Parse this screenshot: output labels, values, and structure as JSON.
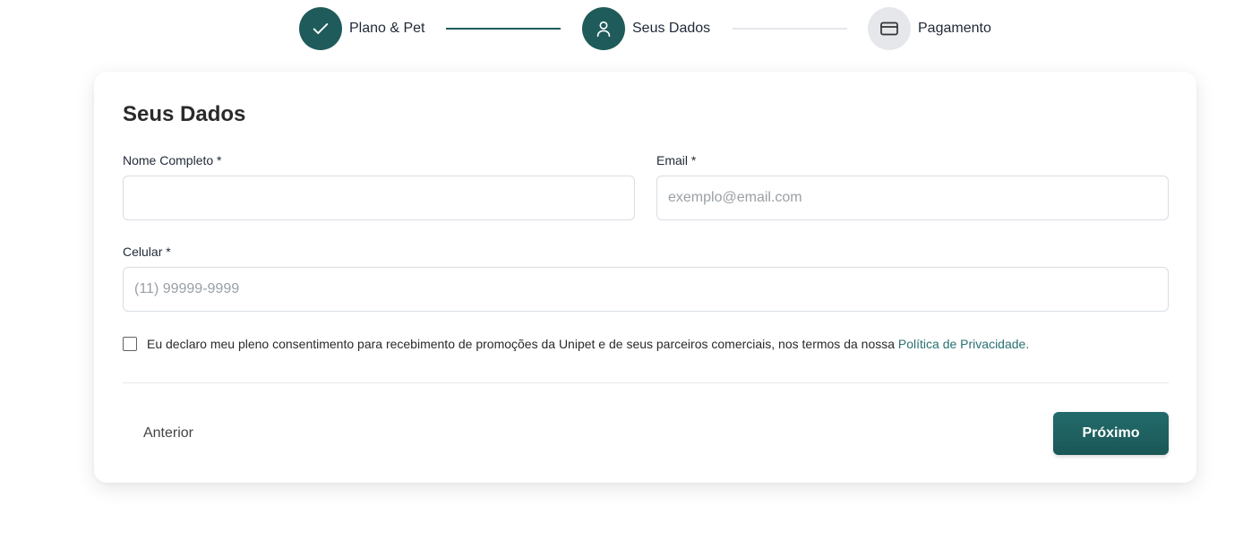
{
  "stepper": {
    "steps": [
      {
        "label": "Plano & Pet",
        "state": "completed",
        "icon": "check-icon"
      },
      {
        "label": "Seus Dados",
        "state": "active",
        "icon": "user-icon"
      },
      {
        "label": "Pagamento",
        "state": "pending",
        "icon": "credit-card-icon"
      }
    ]
  },
  "form": {
    "title": "Seus Dados",
    "name": {
      "label": "Nome Completo *",
      "value": "",
      "placeholder": ""
    },
    "email": {
      "label": "Email *",
      "value": "",
      "placeholder": "exemplo@email.com"
    },
    "phone": {
      "label": "Celular *",
      "value": "",
      "placeholder": "(11) 99999-9999"
    },
    "consent": {
      "checked": false,
      "text": "Eu declaro meu pleno consentimento para recebimento de promoções da Unipet e de seus parceiros comerciais, nos termos da nossa ",
      "link": "Política de Privacidade."
    }
  },
  "actions": {
    "prev_label": "Anterior",
    "next_label": "Próximo"
  },
  "colors": {
    "primary": "#1f5b5b",
    "link": "#2a7070",
    "inactive_step": "#e5e7eb",
    "border": "#d9dde3"
  }
}
